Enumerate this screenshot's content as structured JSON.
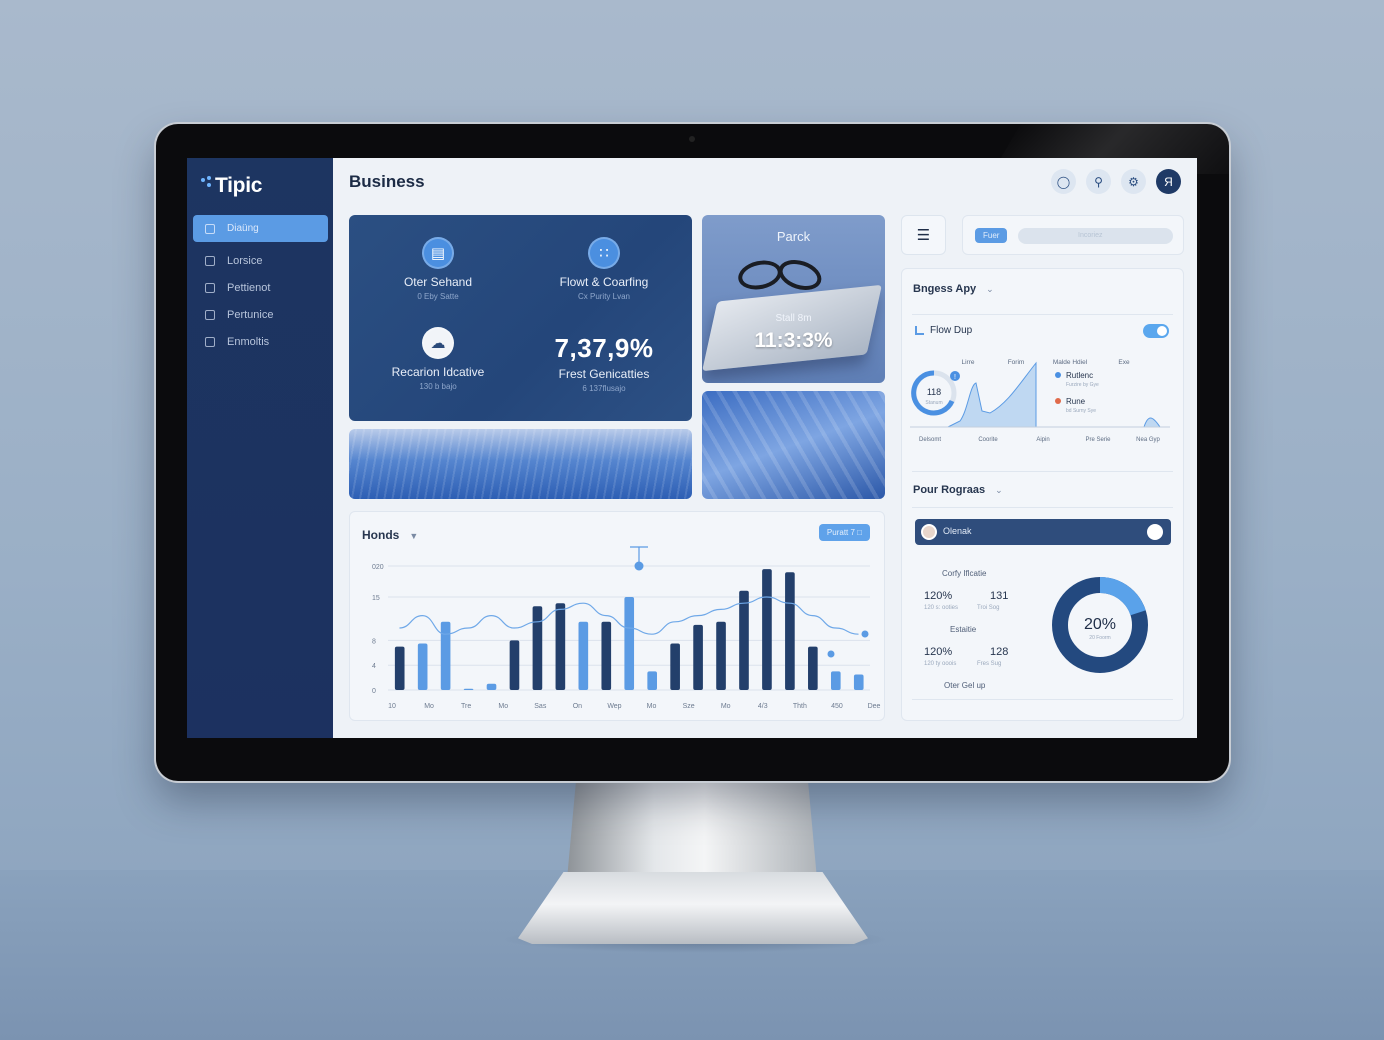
{
  "app": {
    "logo_text": "Tipic",
    "page_title": "Business"
  },
  "sidebar": {
    "items": [
      {
        "label": "Diaüng",
        "active": true
      },
      {
        "label": "Lorsice",
        "active": false
      },
      {
        "label": "Pettienot",
        "active": false
      },
      {
        "label": "Pertunice",
        "active": false
      },
      {
        "label": "Enmoltis",
        "active": false
      }
    ]
  },
  "header": {
    "icons": [
      "chat-icon",
      "search-icon",
      "settings-icon",
      "avatar"
    ],
    "avatar_glyph": "Я"
  },
  "stats": {
    "s1_label": "Oter Sehand",
    "s1_sub": "0 Eby Satte",
    "s2_label": "Flowt & Coarfing",
    "s2_sub": "Cx Purity Lvan",
    "s3_label": "Recarion Idcative",
    "s3_sub": "130 b bajo",
    "s4_value": "7,37,9%",
    "s4_label": "Frest Genicatties",
    "s4_sub": "6 137flusajo"
  },
  "photo": {
    "title": "Parck",
    "sub": "Stall 8m",
    "value": "11:3:3%"
  },
  "chart_card": {
    "title": "Honds",
    "pill": "Puratt 7"
  },
  "chart_data": {
    "type": "bar",
    "title": "Honds",
    "ylim": [
      0,
      20
    ],
    "yticks": [
      "020",
      "15",
      "8",
      "4",
      "0"
    ],
    "xticks": [
      "10",
      "Mo",
      "Tre",
      "Mo",
      "Sas",
      "On",
      "Wep",
      "Mo",
      "Sze",
      "Mo",
      "4/3",
      "Thth",
      "450",
      "Dee"
    ],
    "values": [
      7,
      7.5,
      11,
      0.2,
      1,
      8,
      13.5,
      14,
      11,
      11,
      15,
      3,
      7.5,
      10.5,
      11,
      16,
      19.5,
      19,
      7,
      3,
      2.5
    ],
    "dark": [
      true,
      false,
      false,
      false,
      false,
      true,
      true,
      true,
      false,
      true,
      false,
      false,
      true,
      true,
      true,
      true,
      true,
      true,
      true,
      false,
      false
    ],
    "line": [
      10,
      12,
      9,
      10,
      12,
      10,
      11,
      13,
      14,
      12,
      10,
      9,
      11,
      12,
      13,
      14,
      15,
      14,
      12,
      10,
      9
    ],
    "grid": true
  },
  "right": {
    "search_tag": "Fuer",
    "search_placeholder": "Incoriez",
    "section1_title": "Bngess Apy",
    "flow_label": "Flow Dup",
    "toggle_on": true,
    "mini_cols": [
      "Lirre",
      "Forim",
      "Malde Hdiel",
      "Exe"
    ],
    "mini_x": [
      "Delsomt",
      "Coorite",
      "Aipin",
      "Pre Serie",
      "Nea Gyp"
    ],
    "gauge_value": "118",
    "gauge_sub": "Stanum",
    "legend1": "Rutlenc",
    "legend1_sub": "Furzire by Gye",
    "legend2": "Rune",
    "legend2_sub": "bd Surny Sye",
    "legend1_color": "#4a90e2",
    "legend2_color": "#e06a4a",
    "section2_title": "Pour Rograas",
    "progress_label": "Olenak",
    "m1_label": "Corfy Iflcatie",
    "m1_a": "120%",
    "m1_b": "131",
    "m1_sub_a": "120 s: ooties",
    "m1_sub_b": "Troi Sog",
    "m2_label": "Estaitie",
    "m2_a": "120%",
    "m2_b": "128",
    "m2_sub_a": "120 ty ooois",
    "m2_sub_b": "Fres Sug",
    "bottom_label": "Oter Gel up",
    "donut_value": "20%",
    "donut_sub": "20 Foorm",
    "donut_fraction": 0.2
  },
  "colors": {
    "sidebar": "#1d3561",
    "accent": "#5b9be4",
    "dark_bar": "#233f6b",
    "light_bar": "#5b9be4"
  }
}
